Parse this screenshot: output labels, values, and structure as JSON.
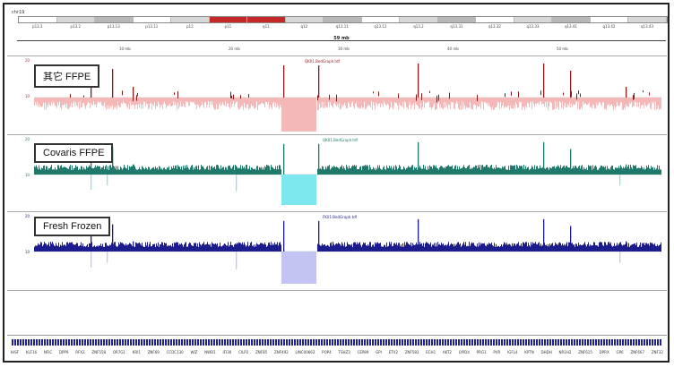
{
  "browser": {
    "chromosome": "chr19",
    "ideogram_bands": [
      "p13.3",
      "p13.2",
      "p13.13",
      "p13.11",
      "p12",
      "p11",
      "q11",
      "q12",
      "q13.11",
      "q13.12",
      "q13.2",
      "q13.31",
      "q13.32",
      "q13.33",
      "q13.41",
      "q13.42",
      "q13.43"
    ],
    "ruler_title": "59 mb",
    "ruler_ticks": [
      "10 mb",
      "20 mb",
      "30 mb",
      "40 mb",
      "50 mb"
    ]
  },
  "tracks": [
    {
      "label": "其它 FFPE",
      "file": "QK01.BedGraph.tdf",
      "scale_top": "20",
      "scale_mid": "10",
      "color": "#8b1a1a",
      "fill": "#f4b8b8"
    },
    {
      "label": "Covaris FFPE",
      "file": "QK01.BedGraph.tdf",
      "scale_top": "20",
      "scale_mid": "10",
      "color": "#1f7a6b",
      "fill": "#7ee7ee"
    },
    {
      "label": "Fresh Frozen",
      "file": "FK01.BedGraph.tdf",
      "scale_top": "20",
      "scale_mid": "10",
      "color": "#1c1c8c",
      "fill": "#c4c4f4"
    }
  ],
  "genes": [
    "IHSF",
    "KLF16",
    "NFIC",
    "DPP9",
    "RFX2",
    "ZNF558",
    "OR7G1",
    "KRI1",
    "ZNF69",
    "CCDC130",
    "WIZ",
    "NWD1",
    "IFI30",
    "CILP2",
    "ZNF85",
    "ZNF492",
    "LINC00662",
    "POP4",
    "TSHZ3",
    "CEP89",
    "GPI",
    "ETV2",
    "ZNF583",
    "ECH1",
    "AKT2",
    "LYPD4",
    "PRG1",
    "PVR",
    "IGFL4",
    "KPTN",
    "DHDH",
    "NR1H2",
    "ZNF615",
    "DPRX",
    "GP6",
    "ZNF667",
    "ZNF32"
  ]
}
